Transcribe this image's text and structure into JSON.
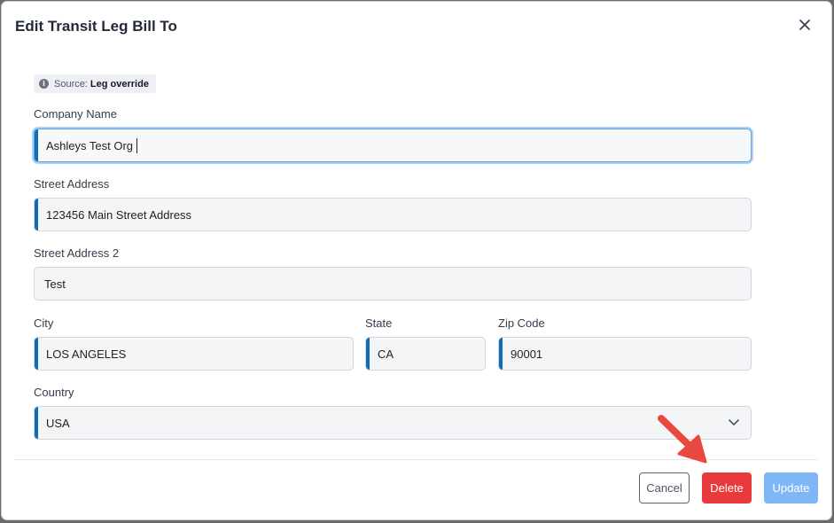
{
  "modal": {
    "title": "Edit Transit Leg Bill To",
    "source_prefix": "Source:",
    "source_value": "Leg override"
  },
  "fields": {
    "company_name": {
      "label": "Company Name",
      "value": "Ashleys Test Org"
    },
    "street_address": {
      "label": "Street Address",
      "value": "123456 Main Street Address"
    },
    "street_address_2": {
      "label": "Street Address 2",
      "value": "Test"
    },
    "city": {
      "label": "City",
      "value": "LOS ANGELES"
    },
    "state": {
      "label": "State",
      "value": "CA"
    },
    "zip": {
      "label": "Zip Code",
      "value": "90001"
    },
    "country": {
      "label": "Country",
      "value": "USA"
    }
  },
  "buttons": {
    "cancel": "Cancel",
    "delete": "Delete",
    "update": "Update"
  },
  "colors": {
    "accent": "#0f6cb6",
    "delete": "#e83a3d",
    "update": "#7fb6f5",
    "annotation_arrow": "#e8483f"
  },
  "icons": {
    "close": "close-icon",
    "info": "info-icon",
    "dropdown": "chevron-down-icon",
    "annotation": "red-arrow-annotation"
  }
}
